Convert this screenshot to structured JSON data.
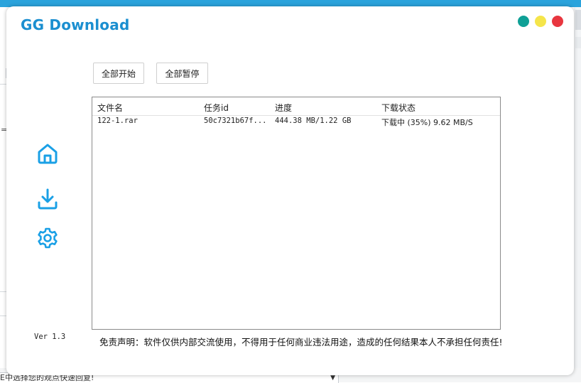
{
  "background": {
    "left_fragment_char": "= j",
    "bottom_select_text": "E中选择您的观点快速回复!",
    "bottom_select_arrow": "▼"
  },
  "app": {
    "title": "GG Download",
    "window_controls": {
      "colors": {
        "teal": "#0fa096",
        "yellow": "#f5e54a",
        "red": "#e8363f"
      }
    },
    "nav": [
      {
        "icon": "home-icon"
      },
      {
        "icon": "download-icon"
      },
      {
        "icon": "gear-icon"
      }
    ],
    "toolbar": {
      "start_all_label": "全部开始",
      "pause_all_label": "全部暂停"
    },
    "table": {
      "headers": [
        "文件名",
        "任务id",
        "进度",
        "下载状态"
      ],
      "rows": [
        {
          "filename": "122-1.rar",
          "task_id": "50c7321b67f...",
          "progress": "444.38 MB/1.22 GB",
          "status": "下载中 (35%) 9.62 MB/S"
        }
      ]
    },
    "version": "Ver 1.3",
    "disclaimer": "免责声明：软件仅供内部交流使用，不得用于任何商业违法用途，造成的任何结果本人不承担任何责任!",
    "accent_color": "#1b8fd0"
  }
}
